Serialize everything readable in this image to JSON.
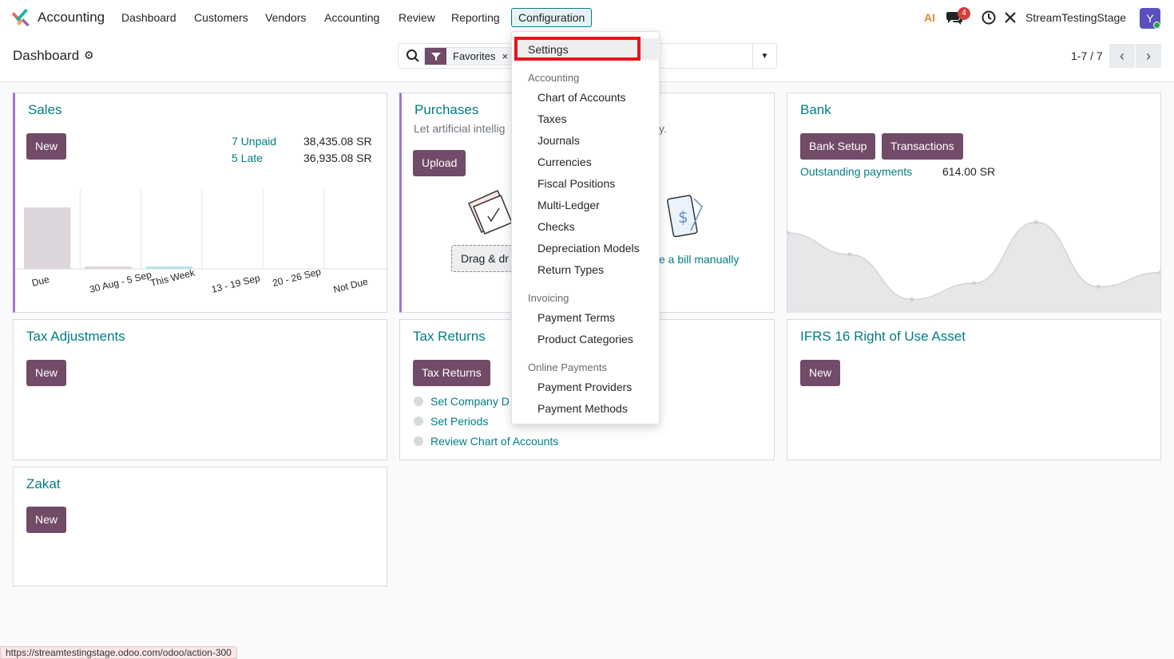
{
  "navbar": {
    "app_name": "Accounting",
    "menu": [
      "Dashboard",
      "Customers",
      "Vendors",
      "Accounting",
      "Review",
      "Reporting",
      "Configuration"
    ],
    "active_menu": "Configuration",
    "ai_label": "AI",
    "messages_count": "4",
    "company": "StreamTestingStage",
    "avatar_letter": "Y"
  },
  "control": {
    "breadcrumb": "Dashboard",
    "facet_label": "Favorites",
    "facet_close": "×",
    "pager": "1-7 / 7"
  },
  "dropdown": {
    "settings": "Settings",
    "sections": [
      {
        "header": "Accounting",
        "items": [
          "Chart of Accounts",
          "Taxes",
          "Journals",
          "Currencies",
          "Fiscal Positions",
          "Multi-Ledger",
          "Checks",
          "Depreciation Models",
          "Return Types"
        ]
      },
      {
        "header": "Invoicing",
        "items": [
          "Payment Terms",
          "Product Categories"
        ]
      },
      {
        "header": "Online Payments",
        "items": [
          "Payment Providers",
          "Payment Methods"
        ]
      }
    ]
  },
  "cards": {
    "sales": {
      "title": "Sales",
      "new_btn": "New",
      "unpaid_label": "7 Unpaid",
      "unpaid_amount": "38,435.08 SR",
      "late_label": "5 Late",
      "late_amount": "36,935.08 SR"
    },
    "purchases": {
      "title": "Purchases",
      "subtitle": "Let artificial intellig",
      "subtitle_tail": "y.",
      "upload_btn": "Upload",
      "drag_label": "Drag & dr",
      "manual_link": "e a bill manually"
    },
    "bank": {
      "title": "Bank",
      "setup_btn": "Bank Setup",
      "transactions_btn": "Transactions",
      "outstanding_label": "Outstanding payments",
      "outstanding_amount": "614.00 SR"
    },
    "tax_adjustments": {
      "title": "Tax Adjustments",
      "new_btn": "New"
    },
    "tax_returns": {
      "title": "Tax Returns",
      "btn": "Tax Returns",
      "steps": [
        "Set Company D",
        "Set Periods",
        "Review Chart of Accounts"
      ]
    },
    "ifrs": {
      "title": "IFRS 16 Right of Use Asset",
      "new_btn": "New"
    },
    "zakat": {
      "title": "Zakat",
      "new_btn": "New"
    }
  },
  "chart_data": {
    "type": "bar",
    "categories": [
      "Due",
      "30 Aug - 5 Sep",
      "This Week",
      "13 - 19 Sep",
      "20 - 26 Sep",
      "Not Due"
    ],
    "values": [
      36935.08,
      1500,
      500,
      0,
      0,
      0
    ],
    "ylim": [
      0,
      48000
    ],
    "title": "",
    "xlabel": "",
    "ylabel": "",
    "colors": [
      "#ddd5dc",
      "#ddd5dc",
      "#b9e1ea",
      "#ddd5dc",
      "#ddd5dc",
      "#ddd5dc"
    ]
  },
  "bank_chart": {
    "type": "area",
    "values": [
      40,
      28,
      3,
      12,
      46,
      10,
      18
    ],
    "ylim": [
      0,
      60
    ]
  },
  "status_url": "https://streamtestingstage.odoo.com/odoo/action-300",
  "colors": {
    "brand": "#714b67",
    "link": "#017e84",
    "highlight_box": "#e8141c"
  }
}
